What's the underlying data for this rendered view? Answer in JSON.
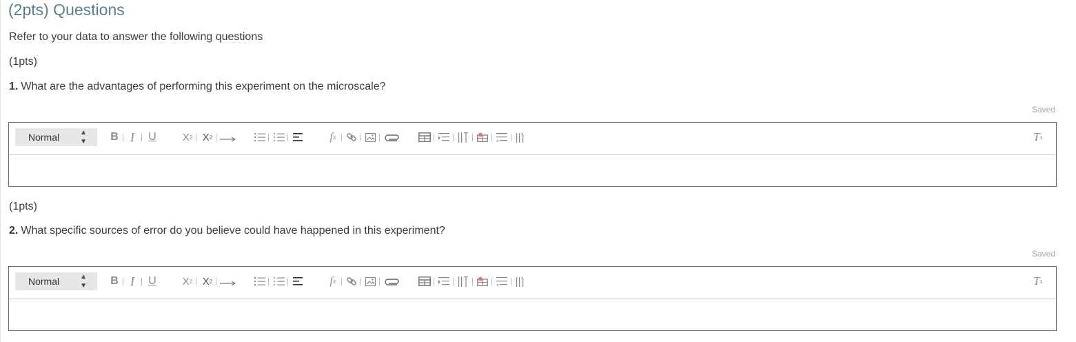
{
  "section": {
    "title": "(2pts) Questions",
    "intro": "Refer to your data to answer the following questions"
  },
  "questions": [
    {
      "points": "(1pts)",
      "number": "1.",
      "text": "What are the advantages of performing this experiment on the microscale?",
      "status": "Saved",
      "editor": {
        "format_value": "Normal",
        "content": ""
      }
    },
    {
      "points": "(1pts)",
      "number": "2.",
      "text": "What specific sources of error do you believe could have happened in this experiment?",
      "status": "Saved",
      "editor": {
        "format_value": "Normal",
        "content": ""
      }
    }
  ],
  "toolbar_icons": [
    "bold-icon",
    "italic-icon",
    "underline-icon",
    "subscript-icon",
    "superscript-icon",
    "arrow-icon",
    "ordered-list-icon",
    "bullet-list-icon",
    "align-icon",
    "formula-icon",
    "link-icon",
    "image-icon",
    "attachment-icon",
    "table-icon",
    "insert-row-above-icon",
    "insert-column-icon",
    "merge-cells-icon",
    "delete-row-icon",
    "delete-column-icon",
    "clear-format-icon"
  ],
  "colors": {
    "title": "#5b7f8a",
    "text": "#3b3b3b",
    "saved": "#a9a9a9",
    "editor_border": "#6b6b6b",
    "icon": "#8a8a8a"
  }
}
